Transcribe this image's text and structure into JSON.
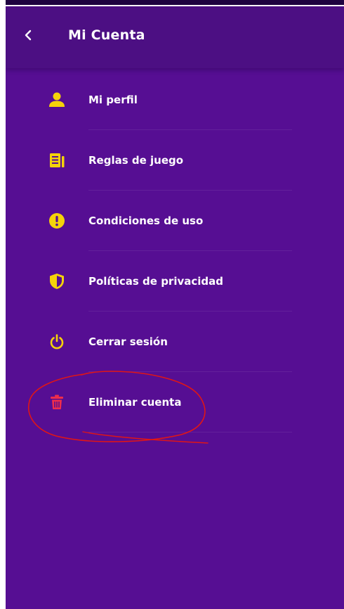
{
  "header": {
    "title": "Mi Cuenta",
    "back_icon": "chevron-left-icon"
  },
  "menu": {
    "items": [
      {
        "label": "Mi perfil",
        "icon": "person-icon",
        "icon_color": "#f5d20a"
      },
      {
        "label": "Reglas de juego",
        "icon": "rules-document-icon",
        "icon_color": "#f5d20a"
      },
      {
        "label": "Condiciones de uso",
        "icon": "alert-circle-icon",
        "icon_color": "#f5d20a"
      },
      {
        "label": "Políticas de privacidad",
        "icon": "shield-icon",
        "icon_color": "#f5d20a"
      },
      {
        "label": "Cerrar sesión",
        "icon": "power-icon",
        "icon_color": "#f5d20a"
      },
      {
        "label": "Eliminar cuenta",
        "icon": "trash-icon",
        "icon_color": "#ef2d4b"
      }
    ]
  },
  "colors": {
    "background": "#560e93",
    "app_bar": "#4c0f83",
    "accent": "#f5d20a",
    "danger": "#ef2d4b",
    "annotation": "#e01616"
  }
}
